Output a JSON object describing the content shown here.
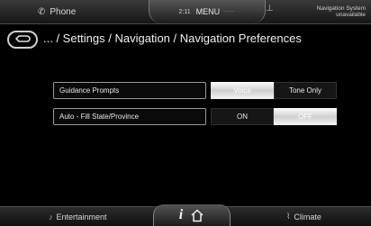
{
  "top_bar": {
    "phone_label": "Phone",
    "phone_icon": "phone-icon",
    "clock": "2:11",
    "menu_label": "MENU",
    "menu_dots": "----",
    "nav_status_line1": "Navigation System",
    "nav_status_line2": "unavailable",
    "nav_icon": "navigation-icon"
  },
  "breadcrumb": {
    "back_icon": "back-arrow-icon",
    "path": "... / Settings / Navigation / Navigation Preferences"
  },
  "settings": [
    {
      "label": "Guidance Prompts",
      "options": [
        "Voice",
        "Tone Only"
      ],
      "selected": "Voice"
    },
    {
      "label": "Auto - Fill State/Province",
      "options": [
        "ON",
        "OFF"
      ],
      "selected": "OFF"
    }
  ],
  "bottom_bar": {
    "entertainment_label": "Entertainment",
    "entertainment_icon": "music-note-icon",
    "info_glyph": "i",
    "home_icon": "home-icon",
    "climate_label": "Climate",
    "climate_icon": "climate-icon"
  },
  "colors": {
    "background": "#000000",
    "selected_option": "#f0f0f0",
    "unselected_option": "#161616",
    "text": "#e8e8e8"
  }
}
